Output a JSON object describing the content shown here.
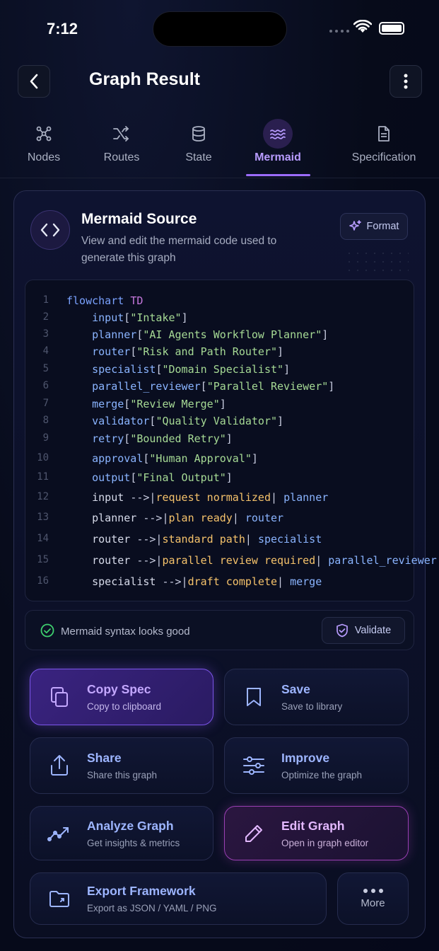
{
  "status_bar": {
    "time": "7:12"
  },
  "header": {
    "title": "Graph Result"
  },
  "tabs": [
    {
      "label": "Nodes",
      "icon": "nodes-icon"
    },
    {
      "label": "Routes",
      "icon": "routes-icon"
    },
    {
      "label": "State",
      "icon": "database-icon"
    },
    {
      "label": "Mermaid",
      "icon": "mermaid-icon",
      "active": true
    },
    {
      "label": "Specification",
      "icon": "document-icon"
    }
  ],
  "source": {
    "title": "Mermaid Source",
    "description": "View and edit the mermaid code used to generate this graph",
    "format_label": "Format"
  },
  "code_lines": [
    {
      "num": "1",
      "text": "flowchart TD"
    },
    {
      "num": "2",
      "text": "    input[\"Intake\"]"
    },
    {
      "num": "3",
      "text": "    planner[\"AI Agents Workflow Planner\"]"
    },
    {
      "num": "4",
      "text": "    router[\"Risk and Path Router\"]"
    },
    {
      "num": "5",
      "text": "    specialist[\"Domain Specialist\"]"
    },
    {
      "num": "6",
      "text": "    parallel_reviewer[\"Parallel Reviewer\"]"
    },
    {
      "num": "7",
      "text": "    merge[\"Review Merge\"]"
    },
    {
      "num": "8",
      "text": "    validator[\"Quality Validator\"]"
    },
    {
      "num": "9",
      "text": "    retry[\"Bounded Retry\"]"
    },
    {
      "num": "10",
      "text": "    approval[\"Human Approval\"]"
    },
    {
      "num": "11",
      "text": "    output[\"Final Output\"]"
    },
    {
      "num": "12",
      "text": "    input -->|request normalized| planner"
    },
    {
      "num": "13",
      "text": "    planner -->|plan ready| router"
    },
    {
      "num": "14",
      "text": "    router -->|standard path| specialist"
    },
    {
      "num": "15",
      "text": "    router -->|parallel review required| parallel_reviewer"
    },
    {
      "num": "16",
      "text": "    specialist -->|draft complete| merge"
    }
  ],
  "validation": {
    "message": "Mermaid syntax looks good",
    "button_label": "Validate"
  },
  "actions": {
    "copy": {
      "title": "Copy Spec",
      "subtitle": "Copy to clipboard"
    },
    "save": {
      "title": "Save",
      "subtitle": "Save to library"
    },
    "share": {
      "title": "Share",
      "subtitle": "Share this graph"
    },
    "improve": {
      "title": "Improve",
      "subtitle": "Optimize the graph"
    },
    "analyze": {
      "title": "Analyze Graph",
      "subtitle": "Get insights & metrics"
    },
    "edit": {
      "title": "Edit Graph",
      "subtitle": "Open in graph editor"
    },
    "export": {
      "title": "Export Framework",
      "subtitle": "Export as JSON / YAML / PNG"
    },
    "more": {
      "label": "More"
    }
  },
  "colors": {
    "accent": "#9c6cff",
    "success": "#3ecf6e",
    "background": "#070b1a"
  }
}
